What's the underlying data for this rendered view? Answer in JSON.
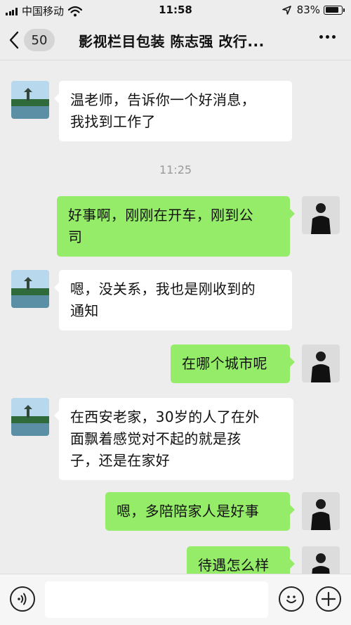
{
  "status_bar": {
    "carrier": "中国移动",
    "time": "11:58",
    "battery_percent": "83%",
    "battery_level": 0.83
  },
  "nav": {
    "unread_count": "50",
    "title": "影视栏目包装 陈志强 改行..."
  },
  "messages": [
    {
      "side": "in",
      "lines": [
        "温老师，告诉你一个好消息，",
        "我找到工作了"
      ]
    },
    {
      "type": "time",
      "text": "11:25"
    },
    {
      "side": "out",
      "lines": [
        "好事啊，刚刚在开车，刚到公",
        "司"
      ]
    },
    {
      "side": "in",
      "lines": [
        "嗯，没关系，我也是刚收到的",
        "通知"
      ]
    },
    {
      "side": "out",
      "lines": [
        "在哪个城市呢"
      ]
    },
    {
      "side": "in",
      "lines": [
        "在西安老家，30岁的人了在外",
        "面飘着感觉对不起的就是孩",
        "子，还是在家好"
      ]
    },
    {
      "side": "out",
      "lines": [
        "嗯，多陪陪家人是好事"
      ]
    },
    {
      "side": "out",
      "lines": [
        "待遇怎么样"
      ]
    }
  ],
  "input": {
    "value": ""
  },
  "icons": {
    "back": "chevron-left-icon",
    "more": "more-dots-icon",
    "voice": "voice-icon",
    "emoji": "emoji-icon",
    "plus": "plus-icon"
  },
  "colors": {
    "background": "#ededed",
    "outgoing_bubble": "#95ec69",
    "incoming_bubble": "#ffffff",
    "timestamp": "#9a9a9a"
  }
}
